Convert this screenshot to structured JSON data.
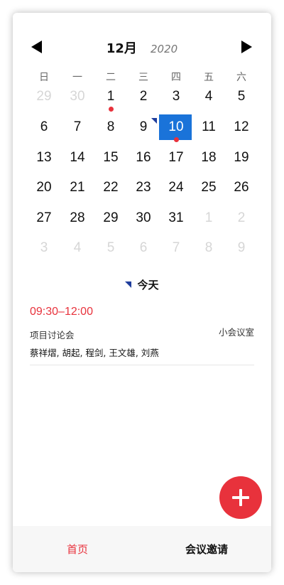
{
  "header": {
    "month": "12月",
    "year": "2020"
  },
  "weekdays": [
    "日",
    "一",
    "二",
    "三",
    "四",
    "五",
    "六"
  ],
  "days": [
    {
      "label": "29",
      "muted": true
    },
    {
      "label": "30",
      "muted": true
    },
    {
      "label": "1",
      "dot": true
    },
    {
      "label": "2"
    },
    {
      "label": "3"
    },
    {
      "label": "4"
    },
    {
      "label": "5"
    },
    {
      "label": "6"
    },
    {
      "label": "7"
    },
    {
      "label": "8"
    },
    {
      "label": "9"
    },
    {
      "label": "10",
      "selected": true,
      "dot": true,
      "today": true
    },
    {
      "label": "11"
    },
    {
      "label": "12"
    },
    {
      "label": "13"
    },
    {
      "label": "14"
    },
    {
      "label": "15"
    },
    {
      "label": "16"
    },
    {
      "label": "17"
    },
    {
      "label": "18"
    },
    {
      "label": "19"
    },
    {
      "label": "20"
    },
    {
      "label": "21"
    },
    {
      "label": "22"
    },
    {
      "label": "23"
    },
    {
      "label": "24"
    },
    {
      "label": "25"
    },
    {
      "label": "26"
    },
    {
      "label": "27"
    },
    {
      "label": "28"
    },
    {
      "label": "29"
    },
    {
      "label": "30"
    },
    {
      "label": "31"
    },
    {
      "label": "1",
      "muted": true
    },
    {
      "label": "2",
      "muted": true
    },
    {
      "label": "3",
      "muted": true
    },
    {
      "label": "4",
      "muted": true
    },
    {
      "label": "5",
      "muted": true
    },
    {
      "label": "6",
      "muted": true
    },
    {
      "label": "7",
      "muted": true
    },
    {
      "label": "8",
      "muted": true
    },
    {
      "label": "9",
      "muted": true
    }
  ],
  "today": {
    "label": "今天"
  },
  "event": {
    "time": "09:30–12:00",
    "title": "项目讨论会",
    "room": "小会议室",
    "people": "蔡祥熠, 胡起, 程剑, 王文雄, 刘燕"
  },
  "fab": {
    "icon": "plus-icon"
  },
  "tabs": {
    "home": "首页",
    "invite": "会议邀请"
  },
  "colors": {
    "accent": "#e8323c",
    "selected": "#1a73d9",
    "today_flag": "#1f3d9c"
  }
}
